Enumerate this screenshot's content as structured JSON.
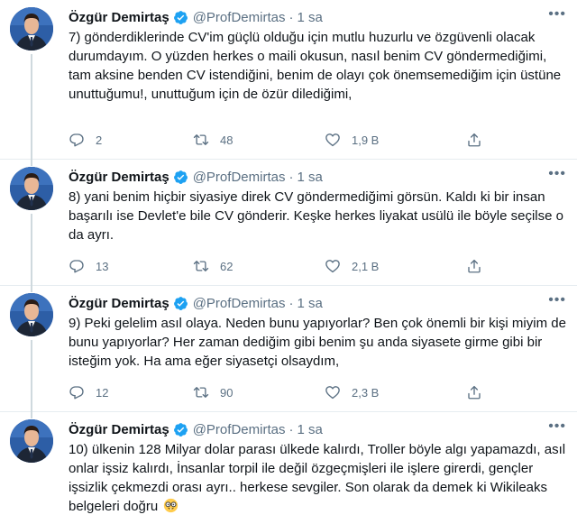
{
  "author": {
    "name": "Özgür Demirtaş",
    "handle": "@ProfDemirtas",
    "separator": "·"
  },
  "colors": {
    "verified": "#1da1f2",
    "muted": "#5b7083",
    "text": "#0f1419"
  },
  "tweets": [
    {
      "time": "1 sa",
      "text": "7) gönderdiklerinde CV'im güçlü olduğu için mutlu huzurlu ve özgüvenli olacak durumdayım. O yüzden herkes o maili okusun, nasıl benim CV göndermediğimi, tam aksine benden CV istendiğini, benim de olayı çok önemsemediğim için üstüne unuttuğumu!, unuttuğum için de özür dilediğimi,",
      "replies": "2",
      "retweets": "48",
      "likes": "1,9 B"
    },
    {
      "time": "1 sa",
      "text": "8) yani benim hiçbir siyasiye direk CV göndermediğimi görsün. Kaldı ki bir insan başarılı ise Devlet'e bile CV gönderir. Keşke herkes liyakat usülü ile böyle seçilse o da ayrı.",
      "replies": "13",
      "retweets": "62",
      "likes": "2,1 B"
    },
    {
      "time": "1 sa",
      "text": "9) Peki gelelim asıl olaya. Neden bunu yapıyorlar? Ben çok önemli bir kişi miyim de bunu yapıyorlar? Her zaman dediğim gibi benim şu anda siyasete girme gibi bir isteğim yok. Ha ama eğer siyasetçi olsaydım,",
      "replies": "12",
      "retweets": "90",
      "likes": "2,3 B"
    },
    {
      "time": "1 sa",
      "text": "10) ülkenin 128 Milyar dolar parası ülkede kalırdı, Troller böyle algı yapamazdı, asıl onlar işsiz kalırdı, İnsanlar torpil ile değil özgeçmişleri ile işlere girerdi, gençler işsizlik çekmezdi orası ayrı.. herkese sevgiler. Son olarak da demek ki Wikileaks belgeleri doğru",
      "emoji": "nerd-face-emoji"
    }
  ]
}
